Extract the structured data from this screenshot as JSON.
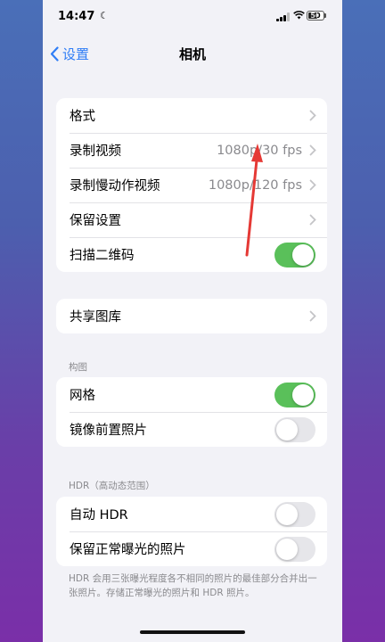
{
  "status_bar": {
    "time": "14:47",
    "battery": "50"
  },
  "nav": {
    "back_label": "设置",
    "title": "相机"
  },
  "group1": {
    "rows": [
      {
        "label": "格式",
        "value": ""
      },
      {
        "label": "录制视频",
        "value": "1080p/30 fps"
      },
      {
        "label": "录制慢动作视频",
        "value": "1080p/120 fps"
      },
      {
        "label": "保留设置",
        "value": ""
      },
      {
        "label": "扫描二维码",
        "toggle": true
      }
    ]
  },
  "group2": {
    "rows": [
      {
        "label": "共享图库"
      }
    ]
  },
  "composition": {
    "header": "构图",
    "rows": [
      {
        "label": "网格",
        "toggle": true
      },
      {
        "label": "镜像前置照片",
        "toggle": false
      }
    ]
  },
  "hdr": {
    "header": "HDR（高动态范围）",
    "rows": [
      {
        "label": "自动 HDR",
        "toggle": false
      },
      {
        "label": "保留正常曝光的照片",
        "toggle": false
      }
    ],
    "footer": "HDR 会用三张曝光程度各不相同的照片的最佳部分合并出一张照片。存储正常曝光的照片和 HDR 照片。"
  },
  "colors": {
    "accent": "#2f7df6",
    "toggle_on": "#5ac05a",
    "annotation_arrow": "#e53935"
  }
}
